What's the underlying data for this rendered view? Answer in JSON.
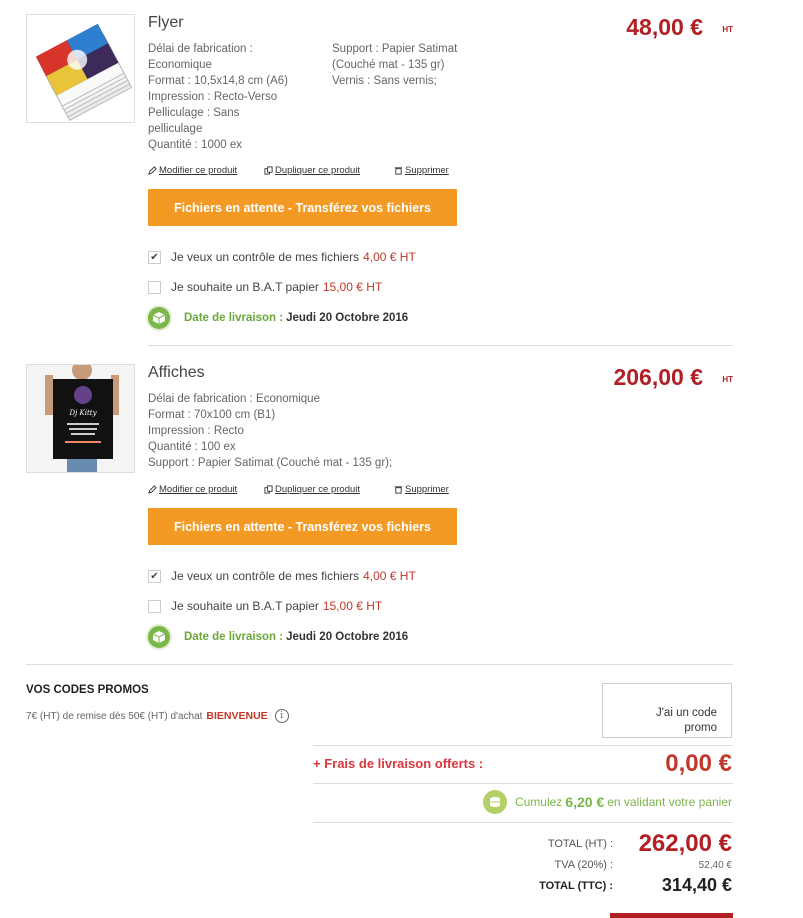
{
  "products": [
    {
      "name": "Flyer",
      "price": "48,00 €",
      "price_suffix": "HT",
      "specs_col1": [
        "Délai de fabrication :",
        "Economique",
        "Format : 10,5x14,8 cm (A6)",
        "Impression : Recto-Verso",
        "Pelliculage : Sans",
        "pelliculage",
        "Quantité : 1000 ex"
      ],
      "specs_col2": [
        "Support : Papier Satimat",
        "(Couché mat - 135 gr)",
        "Vernis : Sans vernis;"
      ],
      "actions": {
        "edit": "Modifier ce produit",
        "duplicate": "Dupliquer ce produit",
        "delete": "Supprimer"
      },
      "upload_button": "Fichiers en attente - Transférez vos fichiers",
      "options": [
        {
          "label": "Je veux un contrôle de mes fichiers",
          "price": "4,00 € HT",
          "checked": true
        },
        {
          "label": "Je souhaite un B.A.T papier",
          "price": "15,00 € HT",
          "checked": false
        }
      ],
      "delivery_label": "Date de livraison :",
      "delivery_date": "Jeudi 20 Octobre 2016"
    },
    {
      "name": "Affiches",
      "price": "206,00 €",
      "price_suffix": "HT",
      "specs_col1": [
        "Délai de fabrication : Economique",
        "Format : 70x100 cm (B1)",
        "Impression : Recto",
        "Quantité : 100 ex",
        "Support : Papier Satimat (Couché mat - 135 gr);"
      ],
      "specs_col2": [],
      "actions": {
        "edit": "Modifier ce produit",
        "duplicate": "Dupliquer ce produit",
        "delete": "Supprimer"
      },
      "upload_button": "Fichiers en attente - Transférez vos fichiers",
      "options": [
        {
          "label": "Je veux un contrôle de mes fichiers",
          "price": "4,00 € HT",
          "checked": true
        },
        {
          "label": "Je souhaite un B.A.T papier",
          "price": "15,00 € HT",
          "checked": false
        }
      ],
      "delivery_label": "Date de livraison :",
      "delivery_date": "Jeudi 20 Octobre 2016",
      "poster_text": "Dj Kitty"
    }
  ],
  "promo": {
    "title": "VOS CODES PROMOS",
    "text": "7€ (HT) de remise dès 50€ (HT) d'achat",
    "code": "BIENVENUE",
    "info_glyph": "i",
    "box_line1": "J'ai un code",
    "box_line2": "promo"
  },
  "shipping": {
    "label": "+ Frais de livraison offerts :",
    "value": "0,00 €"
  },
  "loyalty": {
    "prefix": "Cumulez",
    "amount": "6,20 €",
    "suffix": "en validant votre panier"
  },
  "totals": {
    "ht_label": "TOTAL (HT) :",
    "ht_value": "262,00 €",
    "tva_label": "TVA (20%) :",
    "tva_value": "52,40 €",
    "ttc_label": "TOTAL (TTC) :",
    "ttc_value": "314,40 €"
  },
  "colors": {
    "accent_red": "#b22025",
    "orange": "#f39a24",
    "green": "#7ab648"
  }
}
